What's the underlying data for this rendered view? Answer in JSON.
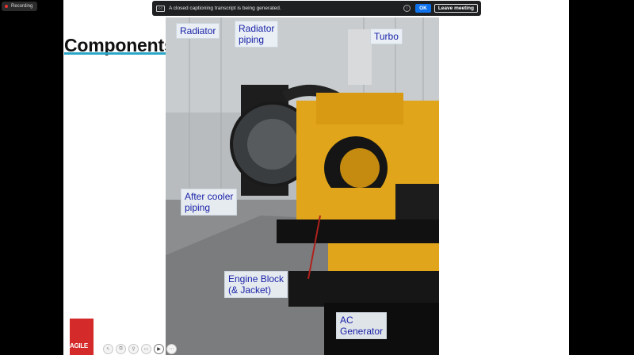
{
  "meeting": {
    "recording_label": "Recording",
    "cc_banner_text": "A closed captioning transcript is being generated.",
    "ok_label": "OK",
    "leave_label": "Leave meeting"
  },
  "slide": {
    "title": "Components",
    "logo_text": "AGILE",
    "callouts": {
      "radiator": "Radiator",
      "radiator_piping": "Radiator\npiping",
      "turbo": "Turbo",
      "after_cooler": "After cooler\npiping",
      "engine_block": "Engine Block\n(& Jacket)",
      "ac_generator": "AC\nGenerator"
    }
  },
  "colors": {
    "accent": "#2aa6c6",
    "callout_text": "#1a22a8",
    "engine_yellow": "#e0a51a",
    "logo_red": "#d42a2a",
    "ok_blue": "#0e72ed"
  }
}
